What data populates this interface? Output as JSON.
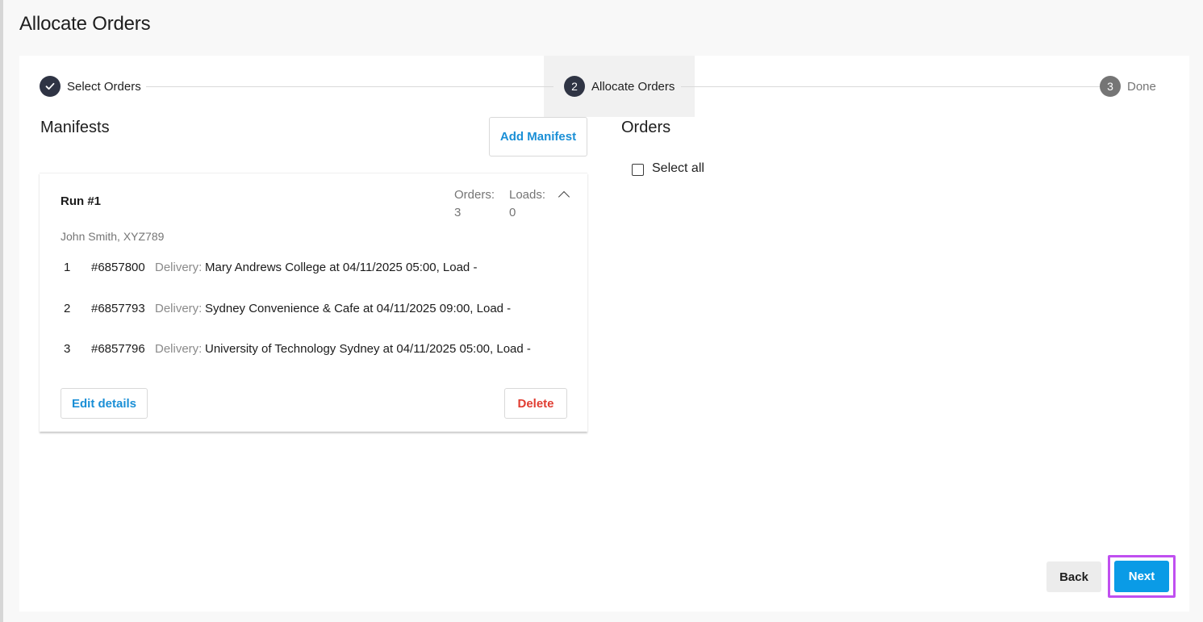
{
  "page": {
    "title": "Allocate Orders"
  },
  "stepper": {
    "steps": [
      {
        "number": "",
        "label": "Select Orders",
        "state": "done"
      },
      {
        "number": "2",
        "label": "Allocate Orders",
        "state": "active"
      },
      {
        "number": "3",
        "label": "Done",
        "state": "todo"
      }
    ]
  },
  "manifests": {
    "title": "Manifests",
    "add_button": "Add Manifest",
    "runs": [
      {
        "title": "Run #1",
        "orders_label": "Orders:",
        "orders_count": "3",
        "loads_label": "Loads:",
        "loads_count": "0",
        "driver": "John Smith, XYZ789",
        "orders": [
          {
            "index": "1",
            "number": "#6857800",
            "type": "Delivery:",
            "description": "Mary Andrews College at 04/11/2025 05:00, Load -"
          },
          {
            "index": "2",
            "number": "#6857793",
            "type": "Delivery:",
            "description": "Sydney Convenience & Cafe at 04/11/2025 09:00, Load -"
          },
          {
            "index": "3",
            "number": "#6857796",
            "type": "Delivery:",
            "description": "University of Technology Sydney at 04/11/2025 05:00, Load -"
          }
        ],
        "edit_button": "Edit details",
        "delete_button": "Delete"
      }
    ]
  },
  "orders": {
    "title": "Orders",
    "select_all_label": "Select all",
    "select_all_checked": false
  },
  "footer": {
    "back_button": "Back",
    "next_button": "Next"
  },
  "colors": {
    "accent_blue": "#0a9be6",
    "link_blue": "#1a8fd6",
    "danger_red": "#e03c31",
    "highlight_outline": "#c04ff0",
    "step_dark": "#2f3444"
  },
  "icons": {
    "step1": "check-icon",
    "collapse": "chevron-up-icon"
  }
}
